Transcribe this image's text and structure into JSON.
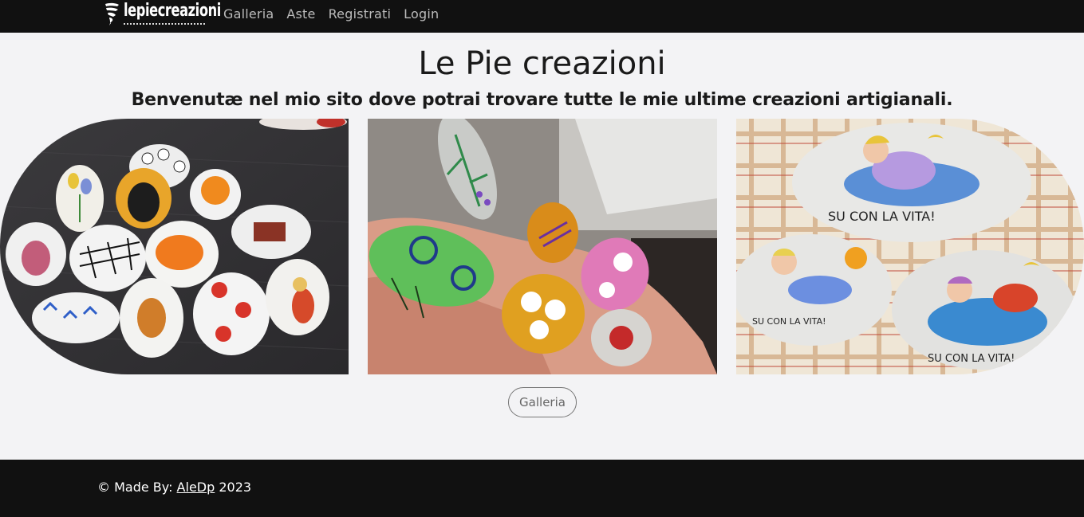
{
  "navbar": {
    "brand": "lepiecreazioni",
    "links": [
      "Galleria",
      "Aste",
      "Registrati",
      "Login"
    ]
  },
  "main": {
    "title": "Le Pie creazioni",
    "subtitle": "Benvenutæ nel mio sito dove potrai trovare tutte le mie ultime creazioni artigianali.",
    "gallery_button": "Galleria",
    "images": [
      {
        "kind": "photo",
        "subject": "painted-stones-on-dark-wood"
      },
      {
        "kind": "photo",
        "subject": "painted-stones-in-hand"
      },
      {
        "kind": "photo",
        "subject": "painted-stones-sleeping-children",
        "text_on_stones": [
          "SU CON LA VITA!",
          "SU CON LA VITA!",
          "SU CON LA VITA!"
        ]
      }
    ]
  },
  "footer": {
    "prefix": "© Made By:",
    "author_link": "AleDp",
    "year": "2023"
  },
  "colors": {
    "navbar_bg": "#111111",
    "page_bg": "#f3f3f5",
    "footer_bg": "#111111",
    "nav_link": "#bcbcbc"
  }
}
